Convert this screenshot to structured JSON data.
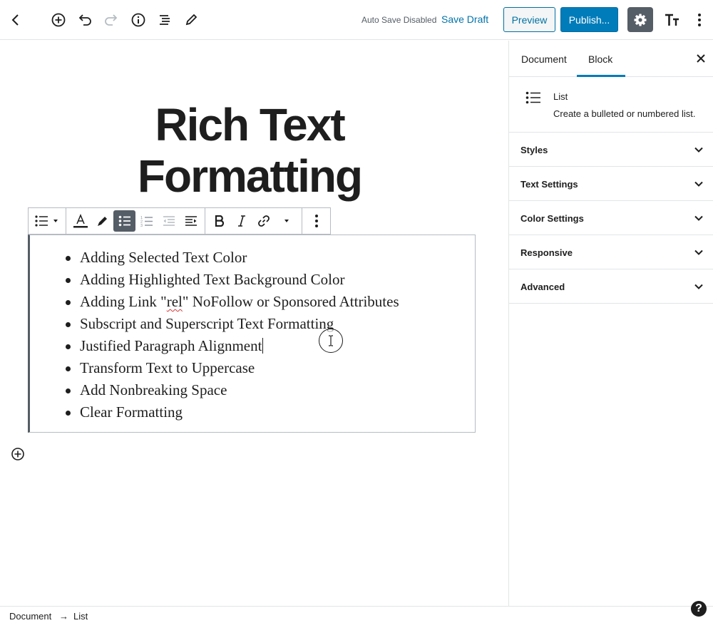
{
  "header": {
    "autosave_status": "Auto Save Disabled",
    "save_draft_label": "Save Draft",
    "preview_label": "Preview",
    "publish_label": "Publish...",
    "icons": [
      "back-chevron-icon",
      "add-block-icon",
      "undo-icon",
      "redo-icon",
      "info-icon",
      "outline-icon",
      "edit-tools-icon",
      "gear-icon",
      "typography-icon",
      "more-options-icon"
    ]
  },
  "editor": {
    "title_line1": "Rich Text",
    "title_line2": "Formatting",
    "list_items": [
      "Adding Selected Text Color",
      "Adding Highlighted Text Background Color",
      "Adding Link \"",
      "Subscript and Superscript Text Formatting",
      "Justified Paragraph Alignment",
      "Transform Text to Uppercase",
      "Add Nonbreaking Space",
      "Clear Formatting"
    ],
    "link_item_prefix": "Adding Link \"",
    "link_item_underlined": "rel",
    "link_item_suffix": "\" NoFollow or Sponsored Attributes",
    "toolbar_icons": [
      "list-block-type-icon",
      "text-color-icon",
      "highlighter-icon",
      "bulleted-list-icon",
      "numbered-list-icon",
      "outdent-icon",
      "indent-icon",
      "bold-icon",
      "italic-icon",
      "link-icon",
      "more-formats-chevron-icon",
      "block-more-options-icon"
    ]
  },
  "sidebar": {
    "tabs": [
      "Document",
      "Block"
    ],
    "active_tab": "Block",
    "block_name": "List",
    "block_description": "Create a bulleted or numbered list.",
    "panels": [
      "Styles",
      "Text Settings",
      "Color Settings",
      "Responsive",
      "Advanced"
    ]
  },
  "footer": {
    "breadcrumb_root": "Document",
    "breadcrumb_arrow": "→",
    "breadcrumb_current": "List",
    "help_label": "?"
  },
  "colors": {
    "accent": "#007cba",
    "link": "#0073aa",
    "dark": "#1e1e1e",
    "toolbar_active": "#555d66",
    "border": "#e2e4e7"
  }
}
